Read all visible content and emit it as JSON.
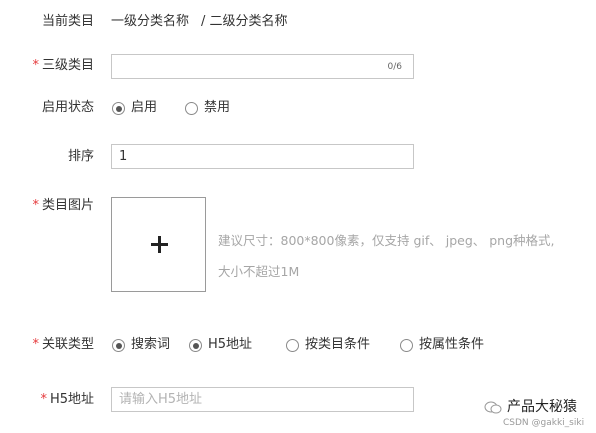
{
  "form": {
    "current_category": {
      "label": "当前类目",
      "level1": "一级分类名称",
      "level2": "/ 二级分类名称"
    },
    "level3_category": {
      "required_mark": "*",
      "label": "三级类目",
      "value": "",
      "counter": "0/6"
    },
    "status": {
      "label": "启用状态",
      "options": [
        {
          "label": "启用",
          "selected": true
        },
        {
          "label": "禁用",
          "selected": false
        }
      ]
    },
    "sort": {
      "label": "排序",
      "value": "1"
    },
    "image": {
      "required_mark": "*",
      "label": "类目图片",
      "hint_line1": "建议尺寸：800*800像素，仅支持 gif、 jpeg、 png种格式,",
      "hint_line2": "大小不超过1M"
    },
    "link_type": {
      "required_mark": "*",
      "label": "关联类型",
      "options": [
        {
          "label": "搜索词",
          "selected": true
        },
        {
          "label": "H5地址",
          "selected": false
        },
        {
          "label": "按类目条件",
          "selected": false
        },
        {
          "label": "按属性条件",
          "selected": false
        }
      ]
    },
    "h5_url": {
      "required_mark": "*",
      "label": "H5地址",
      "placeholder": "请输入H5地址"
    }
  },
  "watermark": {
    "title": "产品大秘猿",
    "sub": "CSDN @gakki_siki"
  }
}
